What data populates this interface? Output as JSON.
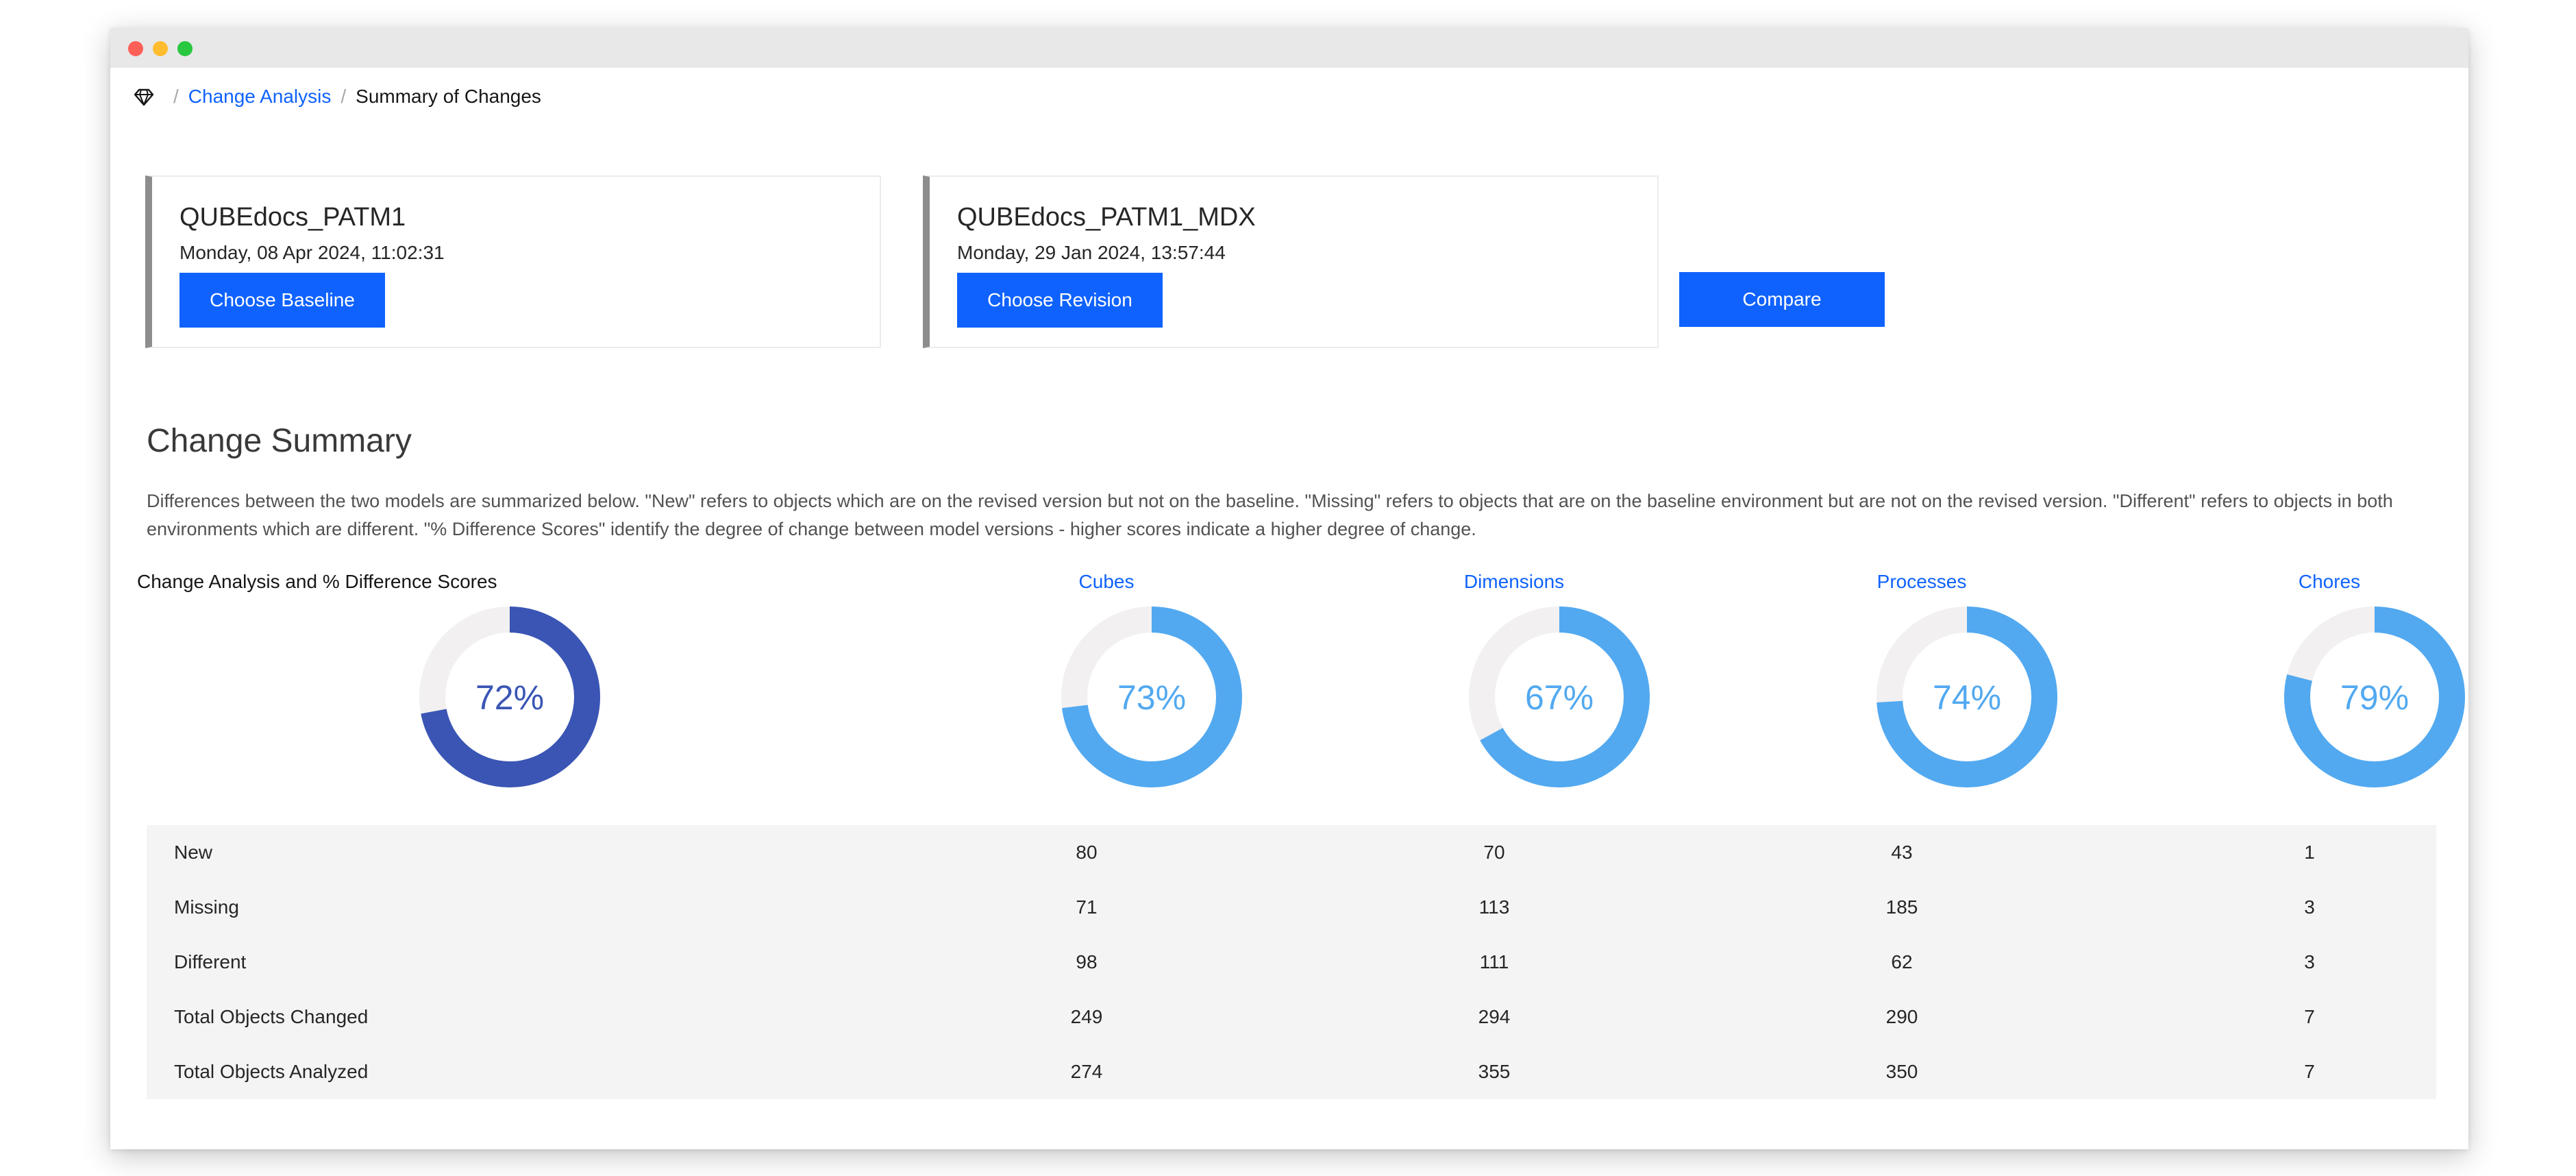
{
  "breadcrumb": {
    "icon": "gem-icon",
    "link": "Change Analysis",
    "current": "Summary of Changes"
  },
  "baseline": {
    "name": "QUBEdocs_PATM1",
    "date": "Monday, 08 Apr 2024, 11:02:31",
    "button": "Choose Baseline"
  },
  "revision": {
    "name": "QUBEdocs_PATM1_MDX",
    "date": "Monday, 29 Jan 2024, 13:57:44",
    "button": "Choose Revision"
  },
  "compare_button": "Compare",
  "summary": {
    "title": "Change Summary",
    "description": "Differences between the two models are summarized below. \"New\" refers to objects which are on the revised version but not on the baseline. \"Missing\" refers to objects that are on the baseline environment but are not on the revised version. \"Different\" refers to objects in both environments which are different. \"% Difference Scores\" identify the degree of change between model versions - higher scores indicate a higher degree of change."
  },
  "colors": {
    "primary": "#0f62fe",
    "donut_main": "#3a55b4",
    "donut_light": "#52a9f0",
    "donut_track": "#f2f0f0"
  },
  "chart_data": [
    {
      "type": "pie",
      "title": "Change Analysis and % Difference Scores",
      "value": 72,
      "label": "72%"
    },
    {
      "type": "pie",
      "title": "Cubes",
      "value": 73,
      "label": "73%"
    },
    {
      "type": "pie",
      "title": "Dimensions",
      "value": 67,
      "label": "67%"
    },
    {
      "type": "pie",
      "title": "Processes",
      "value": 74,
      "label": "74%"
    },
    {
      "type": "pie",
      "title": "Chores",
      "value": 79,
      "label": "79%"
    }
  ],
  "table": {
    "rows": [
      {
        "label": "New",
        "values": [
          "80",
          "70",
          "43",
          "1"
        ]
      },
      {
        "label": "Missing",
        "values": [
          "71",
          "113",
          "185",
          "3"
        ]
      },
      {
        "label": "Different",
        "values": [
          "98",
          "111",
          "62",
          "3"
        ]
      },
      {
        "label": "Total Objects Changed",
        "values": [
          "249",
          "294",
          "290",
          "7"
        ]
      },
      {
        "label": "Total Objects Analyzed",
        "values": [
          "274",
          "355",
          "350",
          "7"
        ]
      }
    ]
  }
}
